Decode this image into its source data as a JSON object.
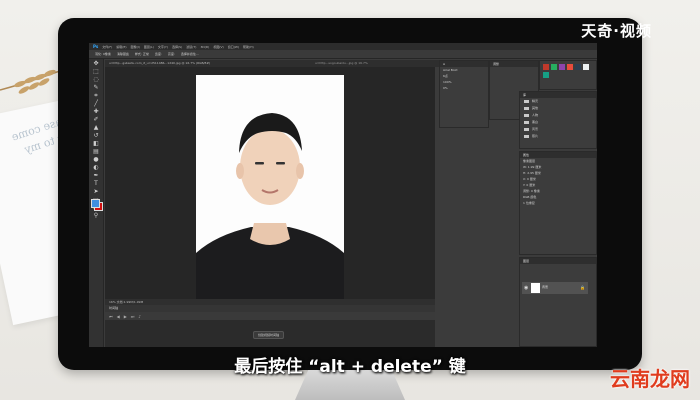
{
  "brand_top": "天奇·视频",
  "brand_bottom": "云南龙网",
  "subtitle": "最后按住 “alt + delete” 键",
  "paper_text": "Please come back to my side",
  "photoshop": {
    "menu_items": [
      "文件(F)",
      "编辑(E)",
      "图像(I)",
      "图层(L)",
      "文字(Y)",
      "选择(S)",
      "滤镜(T)",
      "3D(D)",
      "视图(V)",
      "窗口(W)",
      "帮助(H)"
    ],
    "options": [
      "羽化: 0像素",
      "消除锯齿",
      "样式: 正常",
      "宽度:",
      "高度:",
      "选择并遮住..."
    ],
    "doc_tab": "u=http...gsbaidu.com_it_u=2511486...1240.jpg @ 16.7% (RGB/8#)",
    "doc_tab2": "u=http...sogoubaidu...jpg @ 16.7%",
    "status_text": "16%  文档:1.99M/1.99M",
    "timeline_title": "时间轴",
    "timeline_button": "创建视频时间轴",
    "properties_title": "属性",
    "properties_lines": [
      "像素图层",
      "W: 1.99 厘米",
      "H: 2.95 厘米",
      "X: 0 厘米",
      "Y: 0 厘米",
      "调整: 0 像素",
      "RGB 颜色",
      "1 位重复"
    ],
    "adjust_tab": "调整",
    "libraries_tab": "库",
    "library_folders": [
      "精灵",
      "其他",
      "人物",
      "黑白",
      "风景",
      "照片"
    ],
    "layers_title": "图层",
    "layer_name": "背景",
    "char_lines": [
      "Arial Bold",
      "6点",
      "100%",
      "0%"
    ],
    "colors": {
      "fg": "#3f8fe0",
      "bg": "#d11010",
      "brand_red": "#e03c1e"
    },
    "swatches": [
      "#c0392b",
      "#27ae60",
      "#8e44ad",
      "#e74c3c",
      "#2c3e50",
      "#ecf0f1",
      "#16a085",
      "#d35400",
      "#f39c12",
      "#7f8c8d"
    ],
    "tool_icons": [
      "move-icon",
      "marquee-icon",
      "lasso-icon",
      "quick-select-icon",
      "crop-icon",
      "eyedropper-icon",
      "healing-icon",
      "brush-icon",
      "stamp-icon",
      "history-brush-icon",
      "eraser-icon",
      "gradient-icon",
      "blur-icon",
      "dodge-icon",
      "pen-icon",
      "type-icon",
      "path-select-icon",
      "shape-icon",
      "hand-icon",
      "zoom-icon"
    ]
  }
}
